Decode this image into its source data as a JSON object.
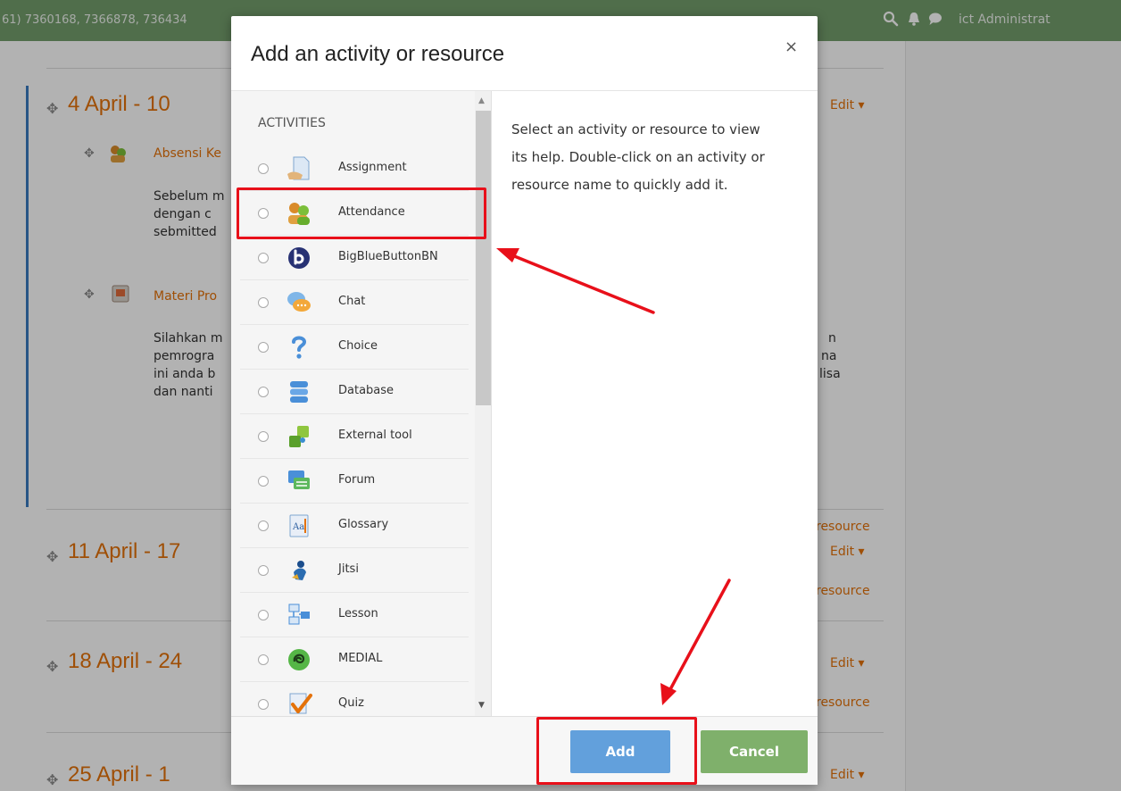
{
  "topbar": {
    "phone": "61) 7360168, 7366878, 736434",
    "user": "ict Administrat",
    "icons": [
      "search-icon",
      "bell-icon",
      "chat-bubble-icon"
    ]
  },
  "course": {
    "weeks": [
      {
        "title": "4 April - 10",
        "edit": "Edit ▾",
        "add_resource": "resource"
      },
      {
        "title": "11 April - 17",
        "edit": "Edit ▾",
        "add_resource": "resource"
      },
      {
        "title": "18 April - 24",
        "edit": "Edit ▾",
        "add_resource": "resource"
      },
      {
        "title": "25 April - 1",
        "edit": "Edit ▾"
      }
    ],
    "activities": [
      {
        "name": "Absensi Ke",
        "desc": [
          "Sebelum m",
          "dengan c",
          "sebmitted"
        ]
      },
      {
        "name": "Materi Pro",
        "desc": [
          "Silahkan m",
          "pemrogra",
          "ini anda b",
          "dan nanti"
        ],
        "right": [
          "n",
          "na",
          "lisa"
        ]
      }
    ]
  },
  "modal": {
    "title": "Add an activity or resource",
    "close": "×",
    "section_heading": "ACTIVITIES",
    "options": [
      {
        "label": "Assignment",
        "icon": "assignment-icon"
      },
      {
        "label": "Attendance",
        "icon": "attendance-icon"
      },
      {
        "label": "BigBlueButtonBN",
        "icon": "bigbluebutton-icon"
      },
      {
        "label": "Chat",
        "icon": "chat-icon"
      },
      {
        "label": "Choice",
        "icon": "choice-icon"
      },
      {
        "label": "Database",
        "icon": "database-icon"
      },
      {
        "label": "External tool",
        "icon": "external-tool-icon"
      },
      {
        "label": "Forum",
        "icon": "forum-icon"
      },
      {
        "label": "Glossary",
        "icon": "glossary-icon"
      },
      {
        "label": "Jitsi",
        "icon": "jitsi-icon"
      },
      {
        "label": "Lesson",
        "icon": "lesson-icon"
      },
      {
        "label": "MEDIAL",
        "icon": "medial-icon"
      },
      {
        "label": "Quiz",
        "icon": "quiz-icon"
      }
    ],
    "help_text": "Select an activity or resource to view its help. Double-click on an activity or resource name to quickly add it.",
    "add_label": "Add",
    "cancel_label": "Cancel"
  },
  "colors": {
    "topbar": "#739e6c",
    "accent_orange": "#e4720a",
    "add_button": "#62a0dc",
    "cancel_button": "#7fb06b",
    "annotation_red": "#e8101a"
  }
}
